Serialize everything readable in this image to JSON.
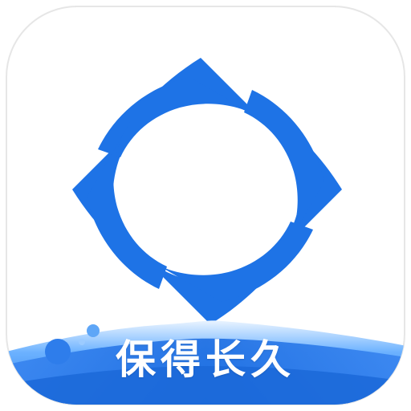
{
  "icon": {
    "slogan": "保得长久",
    "glyph": "blue-diamond-swirl-logo",
    "colors": {
      "primary_blue": "#1E73E6",
      "light_blue": "#6FB7FF",
      "wave_blue": "#2D7BEA",
      "background": "#FFFFFF",
      "border": "#E6E6E6"
    }
  }
}
